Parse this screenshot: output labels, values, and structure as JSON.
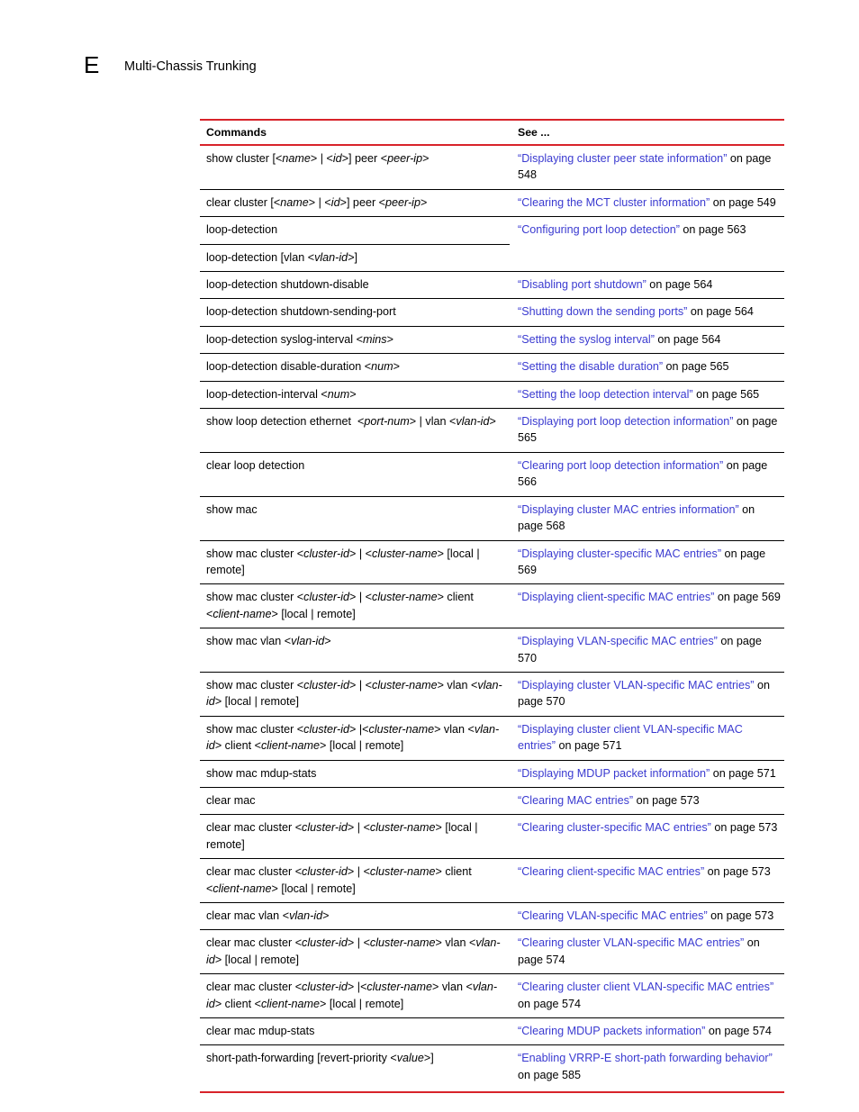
{
  "header": {
    "appendix_letter": "E",
    "title": "Multi-Chassis Trunking"
  },
  "table": {
    "columns": [
      "Commands",
      "See ..."
    ],
    "accent_color": "#D8232A",
    "link_color": "#3A3AD0",
    "rows": [
      {
        "command": "show cluster [<name> | <id>] peer <peer-ip>",
        "link": "“Displaying cluster peer state information”",
        "tail": " on page 548"
      },
      {
        "command": "clear cluster [<name> | <id>] peer <peer-ip>",
        "link": "“Clearing the MCT cluster information”",
        "tail": " on page 549"
      },
      {
        "command": "loop-detection",
        "link": "“Configuring port loop detection”",
        "tail": " on page 563",
        "split_top": true
      },
      {
        "command": "loop-detection [vlan <vlan-id>]",
        "link": "",
        "tail": ""
      },
      {
        "command": "loop-detection shutdown-disable",
        "link": "“Disabling port shutdown”",
        "tail": " on page 564"
      },
      {
        "command": "loop-detection shutdown-sending-port",
        "link": "“Shutting down the sending ports”",
        "tail": " on page 564"
      },
      {
        "command": "loop-detection syslog-interval <mins>",
        "link": "“Setting the syslog interval”",
        "tail": " on page 564"
      },
      {
        "command": "loop-detection disable-duration <num>",
        "link": "“Setting the disable duration”",
        "tail": " on page 565"
      },
      {
        "command": "loop-detection-interval <num>",
        "link": "“Setting the loop detection interval”",
        "tail": " on page 565"
      },
      {
        "command": "show loop detection ethernet  <port-num> | vlan <vlan-id>",
        "link": "“Displaying port loop detection information”",
        "tail": " on page 565"
      },
      {
        "command": "clear loop detection",
        "link": "“Clearing port loop detection information”",
        "tail": " on page 566"
      },
      {
        "command": "show mac",
        "link": "“Displaying cluster MAC entries information”",
        "tail": " on page 568"
      },
      {
        "command": "show mac cluster <cluster-id> | <cluster-name> [local | remote]",
        "link": "“Displaying cluster-specific MAC entries”",
        "tail": " on page 569"
      },
      {
        "command": "show mac cluster <cluster-id> | <cluster-name> client <client-name> [local | remote]",
        "link": "“Displaying client-specific MAC entries”",
        "tail": " on page 569"
      },
      {
        "command": "show mac vlan <vlan-id>",
        "link": "“Displaying VLAN-specific MAC entries”",
        "tail": " on page 570"
      },
      {
        "command": "show mac cluster <cluster-id> | <cluster-name> vlan <vlan-id> [local | remote]",
        "link": "“Displaying cluster VLAN-specific MAC entries”",
        "tail": " on page 570"
      },
      {
        "command": "show mac cluster <cluster-id> |<cluster-name> vlan <vlan-id> client <client-name> [local | remote]",
        "link": "“Displaying cluster client VLAN-specific MAC entries”",
        "tail": " on page 571"
      },
      {
        "command": "show mac mdup-stats",
        "link": "“Displaying MDUP packet information”",
        "tail": " on page 571"
      },
      {
        "command": "clear mac",
        "link": "“Clearing MAC entries”",
        "tail": " on page 573"
      },
      {
        "command": "clear mac cluster <cluster-id> | <cluster-name> [local | remote]",
        "link": "“Clearing cluster-specific MAC entries”",
        "tail": " on page 573"
      },
      {
        "command": "clear mac cluster <cluster-id> | <cluster-name> client <client-name> [local | remote]",
        "link": "“Clearing client-specific MAC entries”",
        "tail": " on page 573"
      },
      {
        "command": "clear mac vlan <vlan-id>",
        "link": "“Clearing VLAN-specific MAC entries”",
        "tail": " on page 573"
      },
      {
        "command": "clear mac cluster <cluster-id> | <cluster-name> vlan <vlan-id> [local | remote]",
        "link": "“Clearing cluster VLAN-specific MAC entries”",
        "tail": " on page 574"
      },
      {
        "command": "clear mac cluster <cluster-id> |<cluster-name> vlan <vlan-id> client <client-name> [local | remote]",
        "link": "“Clearing cluster client VLAN-specific MAC entries”",
        "tail": " on page 574"
      },
      {
        "command": "clear mac mdup-stats",
        "link": "“Clearing MDUP packets information”",
        "tail": " on page 574"
      },
      {
        "command": "short-path-forwarding [revert-priority <value>]",
        "link": "“Enabling VRRP-E short-path forwarding behavior”",
        "tail": " on page 585"
      }
    ]
  }
}
